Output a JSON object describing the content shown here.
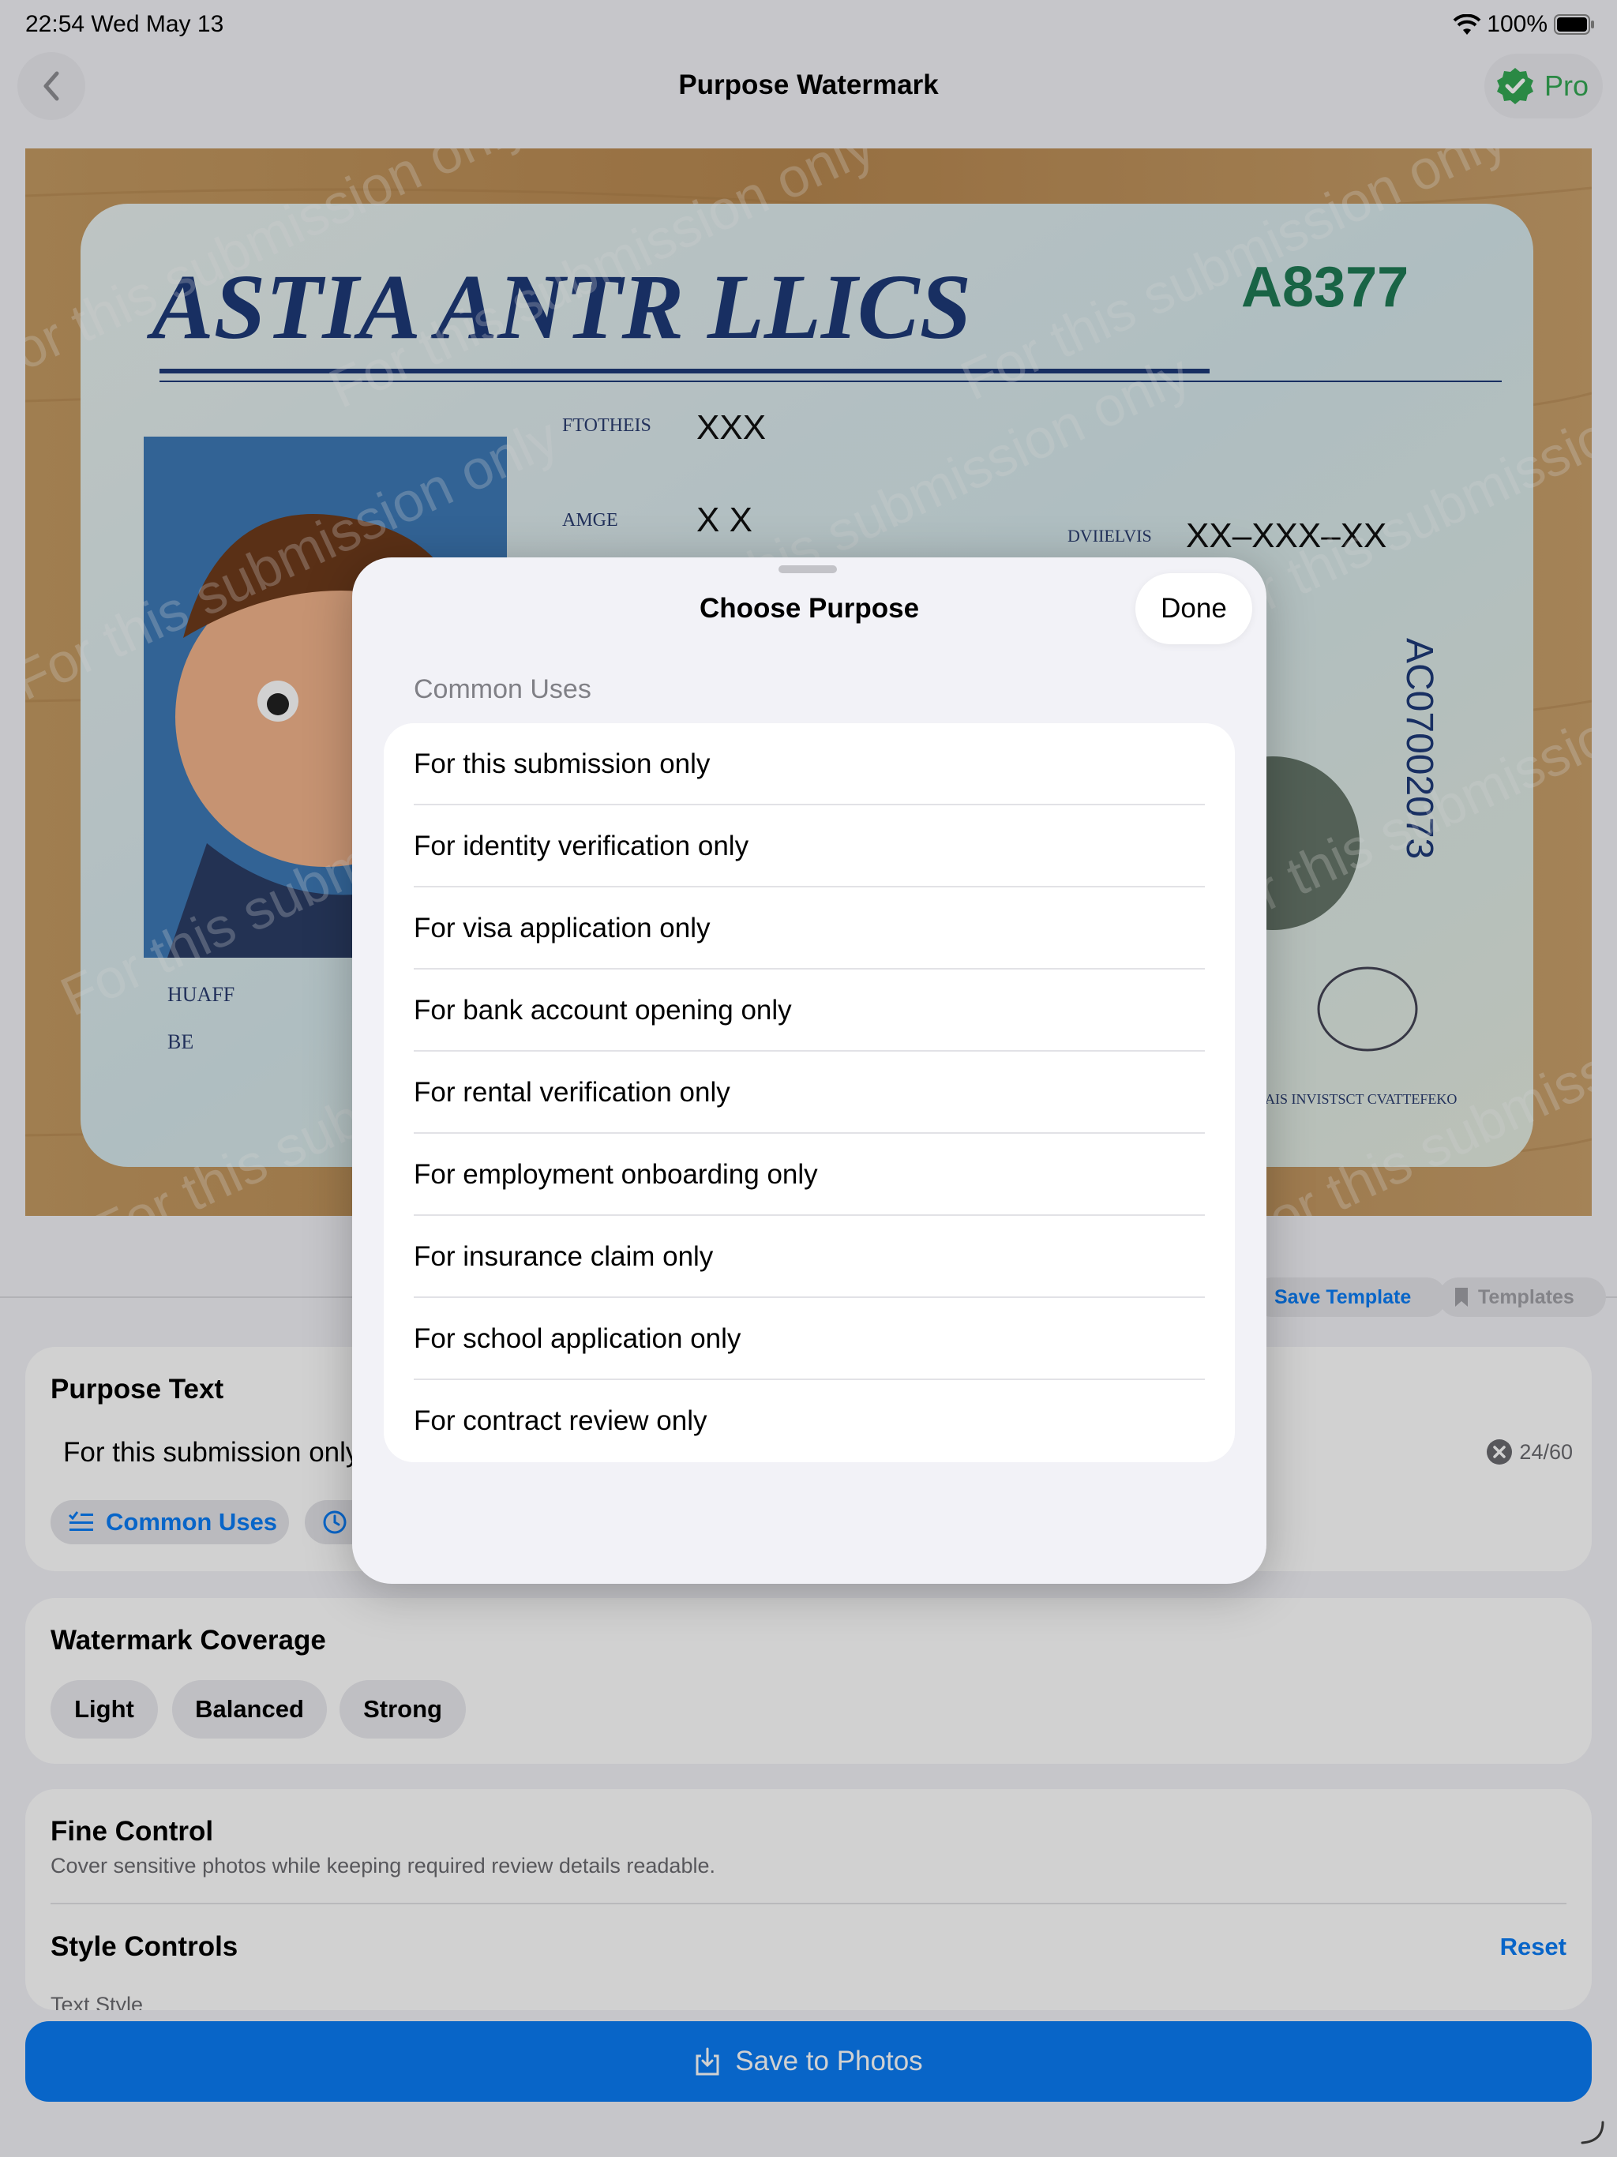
{
  "status_bar": {
    "time": "22:54  Wed May 13",
    "battery": "100%"
  },
  "nav": {
    "title": "Purpose Watermark",
    "pro_label": "Pro"
  },
  "image": {
    "card_title": "ASTIA ANTR LLICS",
    "card_number": "A8377",
    "field1_label": "FTOTHEIS",
    "field1_value": "XXX",
    "field2_label": "AMGE",
    "field2_value": "X  X",
    "field3_label": "DVIIELVIS",
    "field3_value": "XX–XXX–XX",
    "side_number": "AC07002073",
    "bottom_label1": "HUAFF",
    "bottom_label2": "BE",
    "footer": "SAIS INVISTSCT CVATTEFEKO",
    "watermark_text": "For this submission only"
  },
  "toolbar": {
    "save_template": "Save Template",
    "templates": "Templates"
  },
  "purpose_card": {
    "title": "Purpose Text",
    "value": "For this submission only",
    "counter": "24/60",
    "common_uses": "Common Uses"
  },
  "coverage_card": {
    "title": "Watermark Coverage",
    "options": [
      "Light",
      "Balanced",
      "Strong"
    ]
  },
  "fine_card": {
    "title": "Fine Control",
    "subtitle": "Cover sensitive photos while keeping required review details readable.",
    "style_title": "Style Controls",
    "reset": "Reset",
    "partial": "Text Style"
  },
  "save_button": "Save to Photos",
  "sheet": {
    "title": "Choose Purpose",
    "done": "Done",
    "section": "Common Uses",
    "items": [
      "For this submission only",
      "For identity verification only",
      "For visa application only",
      "For bank account opening only",
      "For rental verification only",
      "For employment onboarding only",
      "For insurance claim only",
      "For school application only",
      "For contract review only"
    ]
  },
  "colors": {
    "accent": "#0a7cf5",
    "pro_green": "#34a853",
    "card_blue": "#1e3a78",
    "card_green": "#1f7a55"
  }
}
